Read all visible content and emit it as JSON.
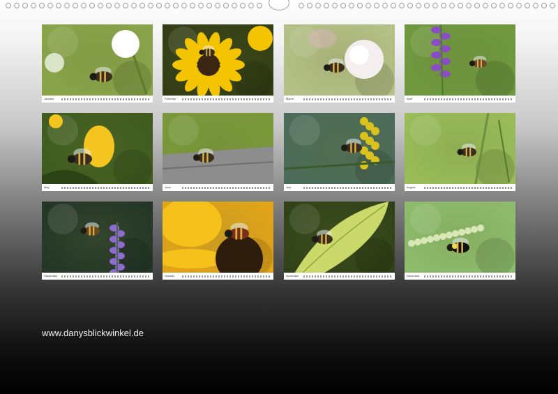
{
  "months": [
    {
      "name": "January",
      "bg": "#8aa64a",
      "accent": "#ffffff",
      "subject": "clover"
    },
    {
      "name": "February",
      "bg": "#2f3a12",
      "accent": "#f5c400",
      "subject": "rudbeckia"
    },
    {
      "name": "March",
      "bg": "#b9c48a",
      "accent": "#f4eeee",
      "subject": "white-rose"
    },
    {
      "name": "April",
      "bg": "#6f9a3e",
      "accent": "#8a4cc7",
      "subject": "vetch"
    },
    {
      "name": "May",
      "bg": "#3d5a1d",
      "accent": "#f3c51e",
      "subject": "yellow-flower"
    },
    {
      "name": "June",
      "bg": "#7a9a3a",
      "accent": "#8d8d8d",
      "subject": "stone"
    },
    {
      "name": "July",
      "bg": "#4a6a5a",
      "accent": "#d9c21e",
      "subject": "goldenrod"
    },
    {
      "name": "August",
      "bg": "#9bbf5a",
      "accent": "#6e8f3b",
      "subject": "grass-stem"
    },
    {
      "name": "September",
      "bg": "#203326",
      "accent": "#8d6bd1",
      "subject": "lavender"
    },
    {
      "name": "October",
      "bg": "#e8a617",
      "accent": "#f7c11c",
      "subject": "rudbeckia-close"
    },
    {
      "name": "November",
      "bg": "#2d3f15",
      "accent": "#cbd96b",
      "subject": "leaf"
    },
    {
      "name": "December",
      "bg": "#8fbf6e",
      "accent": "#d9e6b5",
      "subject": "bumblebee-flower"
    }
  ],
  "website": "www.danysblickwinkel.de"
}
